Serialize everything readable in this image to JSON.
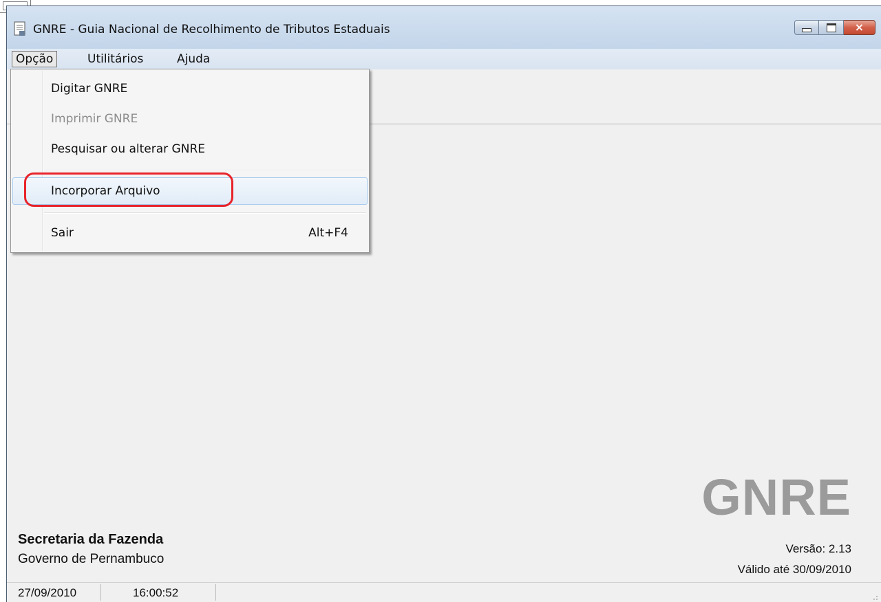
{
  "window": {
    "title": "GNRE - Guia Nacional de Recolhimento de Tributos Estaduais",
    "controls": {
      "close_glyph": "×"
    }
  },
  "menubar": {
    "items": [
      {
        "label": "Opção"
      },
      {
        "label": "Utilitários"
      },
      {
        "label": "Ajuda"
      }
    ]
  },
  "dropdown": {
    "items": [
      {
        "label": "Digitar GNRE",
        "enabled": true
      },
      {
        "label": "Imprimir GNRE",
        "enabled": false
      },
      {
        "label": "Pesquisar ou alterar GNRE",
        "enabled": true
      },
      {
        "label": "Incorporar Arquivo",
        "enabled": true,
        "hover": true,
        "highlighted": true
      },
      {
        "label": "Sair",
        "shortcut": "Alt+F4",
        "enabled": true
      }
    ]
  },
  "footer": {
    "org_title": "Secretaria da Fazenda",
    "org_subtitle": "Governo de Pernambuco",
    "logo": "GNRE",
    "version": "Versão: 2.13",
    "validity": "Válido até 30/09/2010"
  },
  "statusbar": {
    "date": "27/09/2010",
    "time": "16:00:52"
  },
  "colors": {
    "highlight_outline": "#e8232a",
    "logo_gray": "#9b9b9b",
    "hover_border": "#a8cbef"
  }
}
